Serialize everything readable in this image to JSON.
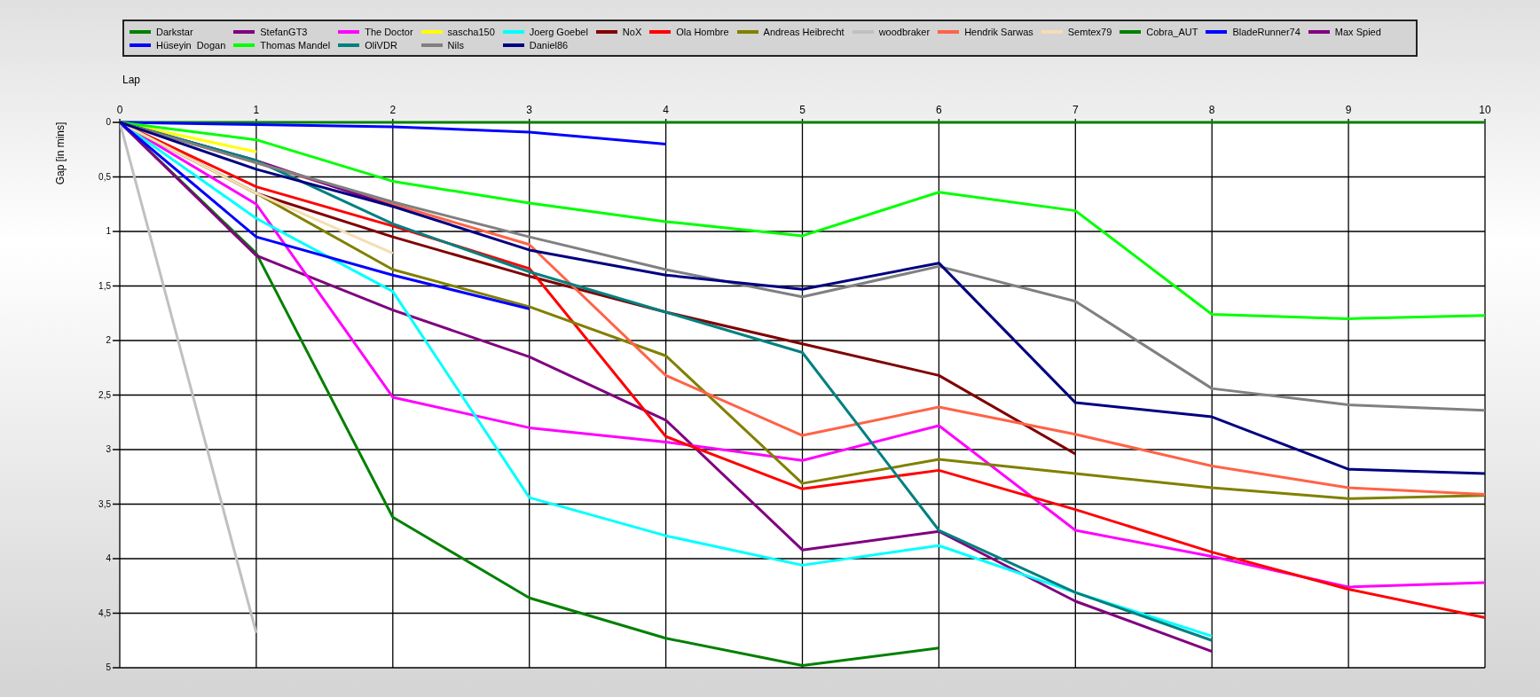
{
  "chart_data": {
    "type": "line",
    "xlabel": "Lap",
    "ylabel": "Gap [in mins]",
    "x": [
      0,
      1,
      2,
      3,
      4,
      5,
      6,
      7,
      8,
      9,
      10
    ],
    "xlim": [
      0,
      10
    ],
    "ylim": [
      5,
      0
    ],
    "grid": true,
    "xticks": [
      0,
      1,
      2,
      3,
      4,
      5,
      6,
      7,
      8,
      9,
      10
    ],
    "yticks": [
      0,
      {
        "value": 0.5,
        "label": "0,5"
      },
      1,
      {
        "value": 1.5,
        "label": "1,5"
      },
      2,
      {
        "value": 2.5,
        "label": "2,5"
      },
      3,
      {
        "value": 3.5,
        "label": "3,5"
      },
      4,
      {
        "value": 4.5,
        "label": "4,5"
      },
      5
    ],
    "series": [
      {
        "name": "Darkstar",
        "color": "#008000",
        "values": [
          0,
          1.2,
          3.62,
          4.36,
          4.73,
          4.98,
          4.82,
          null,
          null,
          null,
          null
        ]
      },
      {
        "name": "StefanGT3",
        "color": "#800080",
        "values": [
          0,
          1.22,
          1.72,
          2.15,
          2.73,
          3.92,
          3.75,
          4.39,
          4.85,
          null,
          null
        ]
      },
      {
        "name": "The Doctor",
        "color": "#ff00ff",
        "values": [
          0,
          0.75,
          2.52,
          2.8,
          2.93,
          3.1,
          2.78,
          3.74,
          3.98,
          4.26,
          4.22
        ]
      },
      {
        "name": "sascha150",
        "color": "#ffff00",
        "values": [
          0,
          0.27,
          null,
          null,
          null,
          null,
          null,
          null,
          null,
          null,
          null
        ]
      },
      {
        "name": "Joerg Goebel",
        "color": "#00ffff",
        "values": [
          0,
          0.88,
          1.55,
          3.44,
          3.79,
          4.06,
          3.88,
          4.31,
          4.71,
          null,
          null
        ]
      },
      {
        "name": "NoX",
        "color": "#800000",
        "values": [
          0,
          0.65,
          1.05,
          1.41,
          1.74,
          2.03,
          2.32,
          3.04,
          null,
          null,
          null
        ]
      },
      {
        "name": "Ola Hombre",
        "color": "#ff0000",
        "values": [
          0,
          0.59,
          0.95,
          1.34,
          2.88,
          3.36,
          3.19,
          3.55,
          3.94,
          4.28,
          4.54
        ]
      },
      {
        "name": "Andreas Heibrecht",
        "color": "#808000",
        "values": [
          0,
          0.65,
          1.35,
          1.69,
          2.14,
          3.31,
          3.09,
          3.22,
          3.35,
          3.45,
          3.42
        ]
      },
      {
        "name": "woodbraker",
        "color": "#c0c0c0",
        "values": [
          0,
          4.68,
          null,
          null,
          null,
          null,
          null,
          null,
          null,
          null,
          null
        ]
      },
      {
        "name": "Hendrik Sarwas",
        "color": "#ff6347",
        "values": [
          0,
          0.37,
          0.75,
          1.12,
          2.32,
          2.87,
          2.61,
          2.86,
          3.15,
          3.35,
          3.41
        ]
      },
      {
        "name": "Semtex79",
        "color": "#f5deb3",
        "values": [
          0,
          0.65,
          1.2,
          null,
          null,
          null,
          null,
          null,
          null,
          null,
          null
        ]
      },
      {
        "name": "Cobra_AUT",
        "color": "#008000",
        "values": [
          0,
          0,
          0,
          0,
          0,
          0,
          0,
          0,
          0,
          0,
          0
        ]
      },
      {
        "name": "BladeRunner74",
        "color": "#0000ff",
        "values": [
          0,
          0.02,
          0.04,
          0.09,
          0.2,
          null,
          null,
          null,
          null,
          null,
          null
        ]
      },
      {
        "name": "Max Spied",
        "color": "#800080",
        "values": [
          0,
          0.35,
          0.77,
          null,
          null,
          null,
          null,
          null,
          null,
          null,
          null
        ]
      },
      {
        "name": "Hüseyin  Dogan",
        "color": "#0000ff",
        "values": [
          0,
          1.05,
          1.4,
          1.71,
          null,
          null,
          null,
          null,
          null,
          null,
          null
        ]
      },
      {
        "name": "Thomas Mandel",
        "color": "#00ff00",
        "values": [
          0,
          0.16,
          0.54,
          0.74,
          0.91,
          1.04,
          0.64,
          0.81,
          1.76,
          1.8,
          1.77
        ]
      },
      {
        "name": "OliVDR",
        "color": "#008080",
        "values": [
          0,
          0.35,
          0.93,
          1.37,
          1.74,
          2.11,
          3.74,
          4.31,
          4.75,
          null,
          null
        ]
      },
      {
        "name": "Nils",
        "color": "#808080",
        "values": [
          0,
          0.37,
          0.73,
          1.05,
          1.35,
          1.6,
          1.32,
          1.64,
          2.44,
          2.59,
          2.64
        ]
      },
      {
        "name": "Daniel86",
        "color": "#000080",
        "values": [
          0,
          0.43,
          0.77,
          1.17,
          1.4,
          1.53,
          1.29,
          2.57,
          2.7,
          3.18,
          3.22
        ]
      }
    ]
  }
}
